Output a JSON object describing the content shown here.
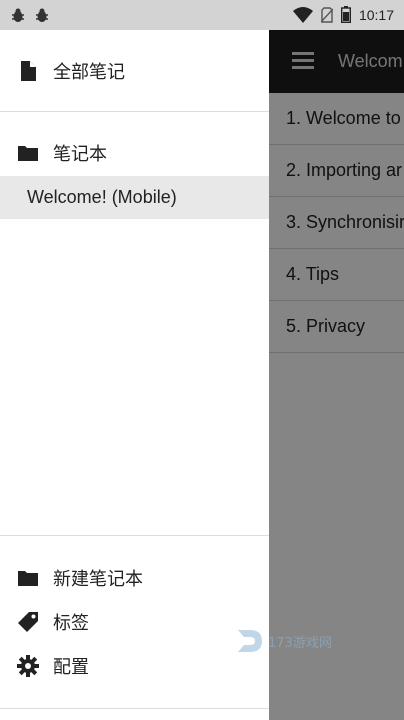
{
  "status_bar": {
    "time": "10:17",
    "icons": [
      "bug-icon",
      "bug-icon",
      "wifi-icon",
      "no-sim-icon",
      "battery-icon"
    ]
  },
  "app": {
    "toolbar_title": "Welcom",
    "menu_icon": "hamburger-menu-icon",
    "notes": [
      "1. Welcome to",
      "2. Importing ar",
      "3. Synchronisir",
      "4. Tips",
      "5. Privacy"
    ]
  },
  "drawer": {
    "all_notes": {
      "label": "全部笔记",
      "icon": "file-icon"
    },
    "notebooks": {
      "label": "笔记本",
      "icon": "folder-icon"
    },
    "selected_notebook": "Welcome! (Mobile)",
    "new_notebook": {
      "label": "新建笔记本",
      "icon": "folder-icon"
    },
    "tags": {
      "label": "标签",
      "icon": "tag-icon"
    },
    "settings": {
      "label": "配置",
      "icon": "gear-icon"
    }
  },
  "watermark": {
    "text": "173游戏网"
  },
  "colors": {
    "toolbar": "#1e1e1e",
    "status_bar": "#d3d3d3",
    "selected_row": "#e8e8e8",
    "scrim": "rgba(0,0,0,0.48)"
  }
}
